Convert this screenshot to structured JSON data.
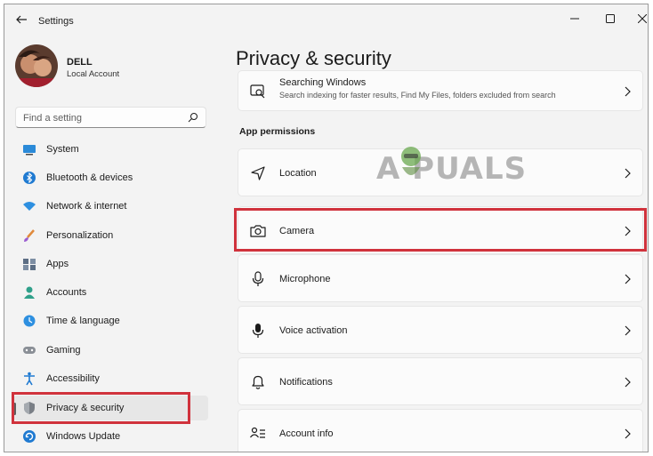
{
  "window": {
    "title": "Settings"
  },
  "profile": {
    "name": "DELL",
    "account_type": "Local Account"
  },
  "search": {
    "placeholder": "Find a setting"
  },
  "sidebar": {
    "items": [
      {
        "label": "System",
        "icon": "monitor-icon"
      },
      {
        "label": "Bluetooth & devices",
        "icon": "bluetooth-icon"
      },
      {
        "label": "Network & internet",
        "icon": "wifi-icon"
      },
      {
        "label": "Personalization",
        "icon": "brush-icon"
      },
      {
        "label": "Apps",
        "icon": "apps-icon"
      },
      {
        "label": "Accounts",
        "icon": "person-icon"
      },
      {
        "label": "Time & language",
        "icon": "clock-globe-icon"
      },
      {
        "label": "Gaming",
        "icon": "gamepad-icon"
      },
      {
        "label": "Accessibility",
        "icon": "accessibility-icon"
      },
      {
        "label": "Privacy & security",
        "icon": "shield-icon",
        "selected": true
      },
      {
        "label": "Windows Update",
        "icon": "update-icon"
      }
    ]
  },
  "main": {
    "title": "Privacy & security",
    "top_card": {
      "title": "Searching Windows",
      "subtitle": "Search indexing for faster results, Find My Files, folders excluded from search"
    },
    "section_label": "App permissions",
    "permissions": [
      {
        "label": "Location",
        "icon": "location-icon"
      },
      {
        "label": "Camera",
        "icon": "camera-icon",
        "highlighted": true
      },
      {
        "label": "Microphone",
        "icon": "microphone-icon"
      },
      {
        "label": "Voice activation",
        "icon": "voice-icon"
      },
      {
        "label": "Notifications",
        "icon": "bell-icon"
      },
      {
        "label": "Account info",
        "icon": "account-info-icon"
      }
    ]
  },
  "watermark": {
    "text": "A PUALS"
  },
  "colors": {
    "highlight_box": "#d0323c",
    "accent": "#0067c0",
    "background": "#f3f3f3"
  }
}
